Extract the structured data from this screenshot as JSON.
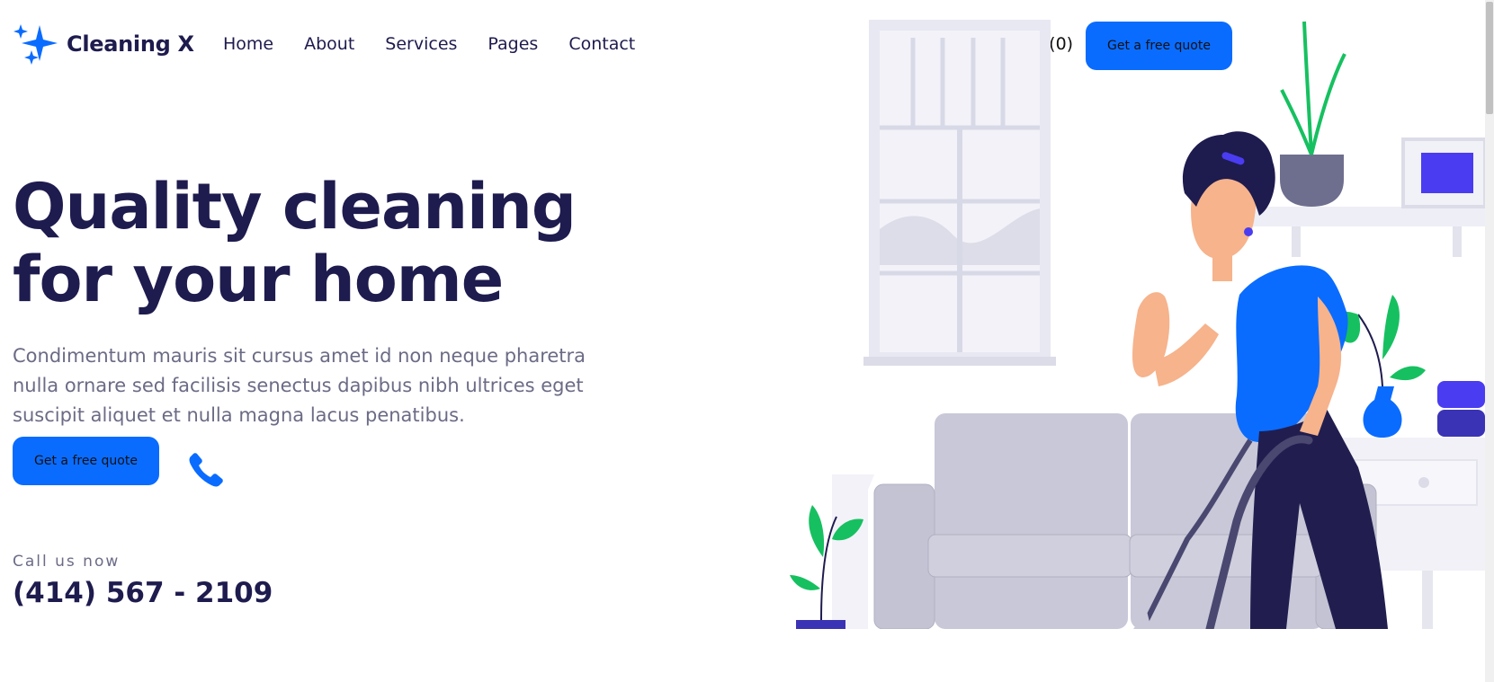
{
  "header": {
    "logo_text": "Cleaning X",
    "nav": [
      "Home",
      "About",
      "Services",
      "Pages",
      "Contact"
    ],
    "cart_label": "Cart(0)",
    "cta_label": "Get a free quote"
  },
  "hero": {
    "title_line1": "Quality cleaning",
    "title_line2": "for your home",
    "description": "Condimentum mauris sit cursus amet id non neque pharetra nulla ornare sed facilisis senectus dapibus nibh ultrices eget suscipit aliquet et nulla magna lacus penatibus.",
    "cta_label": "Get a free quote",
    "call_label": "Call us now",
    "phone_number": "(414) 567 - 2109"
  },
  "colors": {
    "brand_blue": "#0a6cff",
    "heading_navy": "#1e1b4e",
    "body_gray": "#6b6b86"
  },
  "icons": [
    "sparkle-logo-icon",
    "phone-icon"
  ]
}
